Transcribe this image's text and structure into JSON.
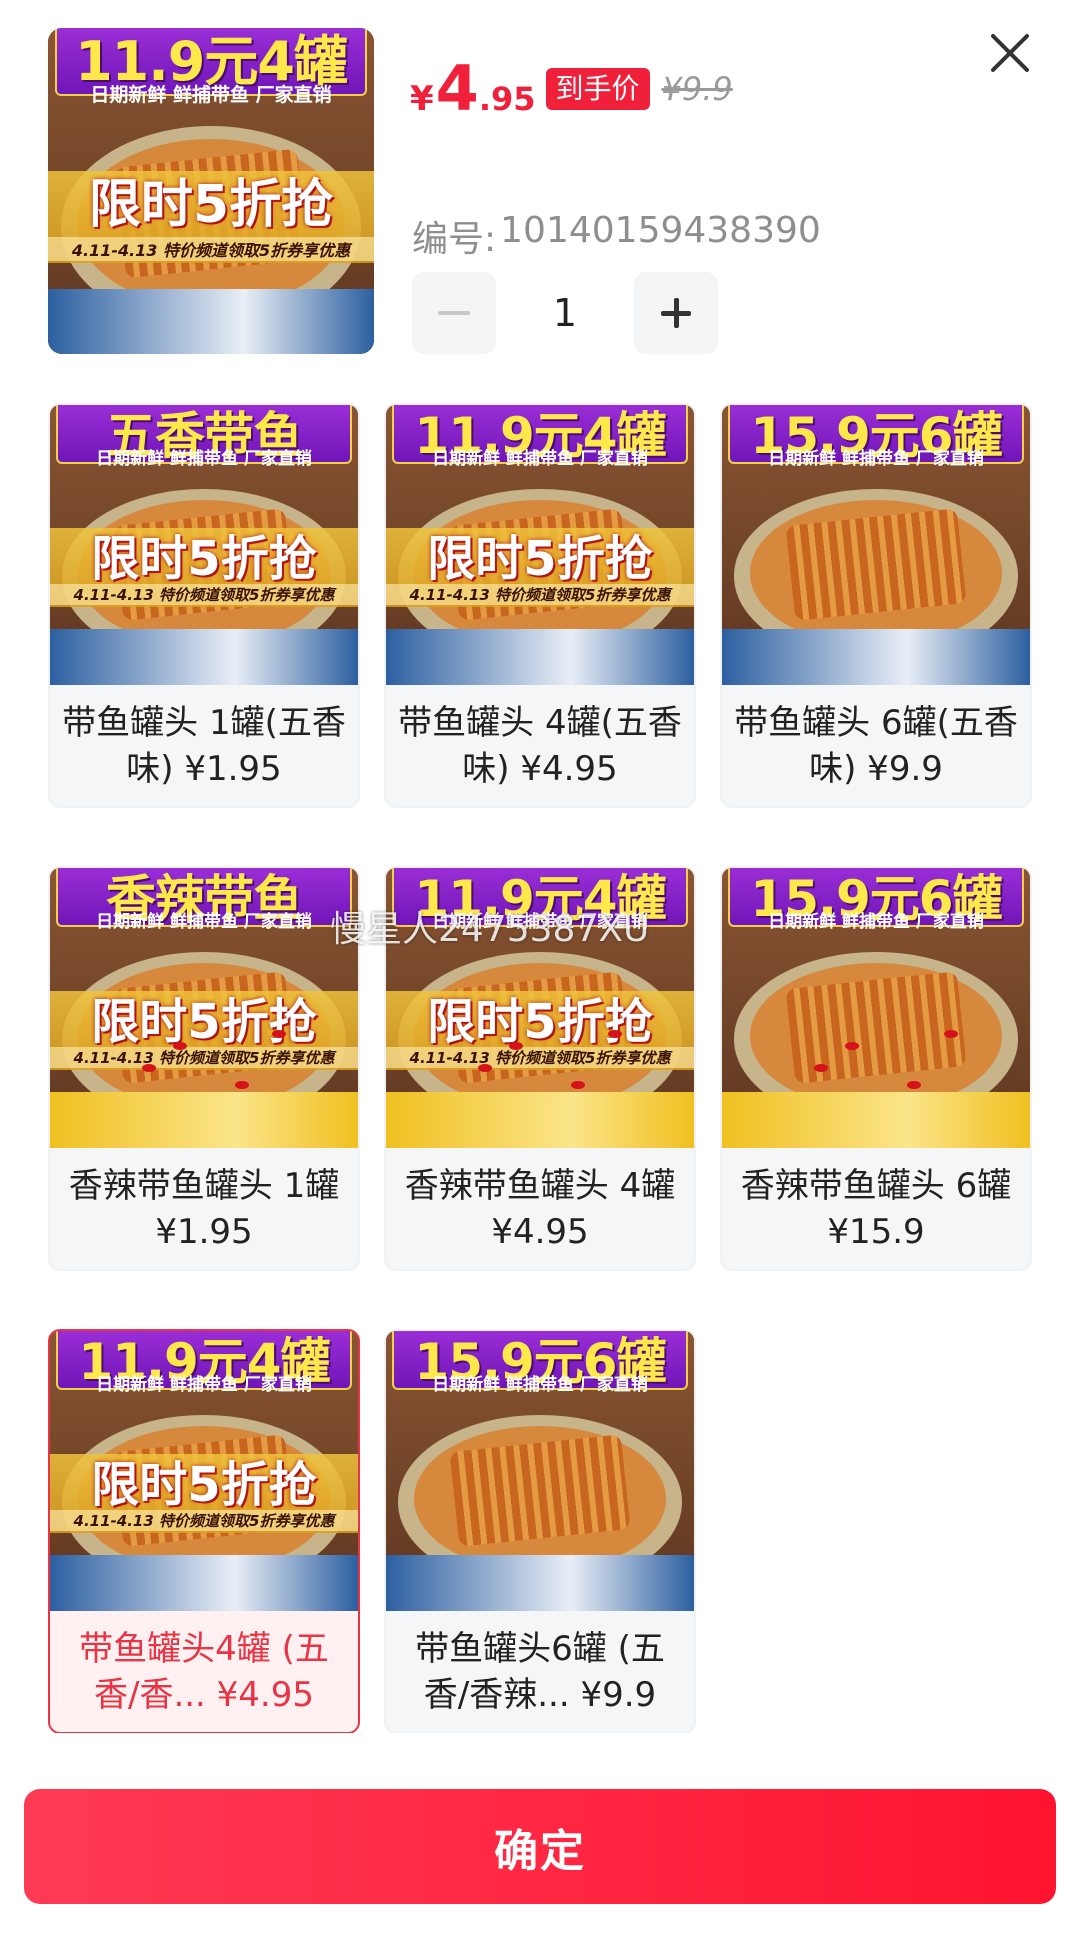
{
  "header": {
    "main_image": {
      "top_title": "11.9元4罐",
      "top_sub": "日期新鲜  鲜捕带鱼  厂家直销",
      "promo_title": "限时5折抢",
      "promo_sub": "4.11-4.13 特价频道领取5折券享优惠",
      "variant": "plain"
    },
    "price": {
      "currency": "¥",
      "integer": "4",
      "decimal": ".95"
    },
    "price_badge": "到手价",
    "original_price": "¥9.9",
    "code_label": "编号:",
    "code_value": "10140159438390",
    "quantity": "1"
  },
  "skus": [
    {
      "label": "带鱼罐头 1罐(五香味) ¥1.95",
      "selected": false,
      "image": {
        "top_title": "五香带鱼",
        "top_sub": "日期新鲜  鲜捕带鱼  厂家直销",
        "promo_title": "限时5折抢",
        "promo_sub": "4.11-4.13 特价频道领取5折券享优惠",
        "variant": "plain"
      }
    },
    {
      "label": "带鱼罐头 4罐(五香味) ¥4.95",
      "selected": false,
      "image": {
        "top_title": "11.9元4罐",
        "top_sub": "日期新鲜  鲜捕带鱼  厂家直销",
        "promo_title": "限时5折抢",
        "promo_sub": "4.11-4.13 特价频道领取5折券享优惠",
        "variant": "plain"
      }
    },
    {
      "label": "带鱼罐头 6罐(五香味) ¥9.9",
      "selected": false,
      "image": {
        "top_title": "15.9元6罐",
        "top_sub": "日期新鲜  鲜捕带鱼  厂家直销",
        "promo_title": "",
        "promo_sub": "",
        "variant": "plain"
      }
    },
    {
      "label": "香辣带鱼罐头 1罐 ¥1.95",
      "selected": false,
      "image": {
        "top_title": "香辣带鱼",
        "top_sub": "日期新鲜  鲜捕带鱼  厂家直销",
        "promo_title": "限时5折抢",
        "promo_sub": "4.11-4.13 特价频道领取5折券享优惠",
        "variant": "spicy"
      }
    },
    {
      "label": "香辣带鱼罐头 4罐 ¥4.95",
      "selected": false,
      "image": {
        "top_title": "11.9元4罐",
        "top_sub": "日期新鲜  鲜捕带鱼  厂家直销",
        "promo_title": "限时5折抢",
        "promo_sub": "4.11-4.13 特价频道领取5折券享优惠",
        "variant": "spicy"
      }
    },
    {
      "label": "香辣带鱼罐头 6罐 ¥15.9",
      "selected": false,
      "image": {
        "top_title": "15.9元6罐",
        "top_sub": "日期新鲜  鲜捕带鱼  厂家直销",
        "promo_title": "",
        "promo_sub": "",
        "variant": "spicy"
      }
    },
    {
      "label": "带鱼罐头4罐 (五香/香... ¥4.95",
      "selected": true,
      "image": {
        "top_title": "11.9元4罐",
        "top_sub": "日期新鲜  鲜捕带鱼  厂家直销",
        "promo_title": "限时5折抢",
        "promo_sub": "4.11-4.13 特价频道领取5折券享优惠",
        "variant": "plain"
      }
    },
    {
      "label": "带鱼罐头6罐 (五香/香辣... ¥9.9",
      "selected": false,
      "image": {
        "top_title": "15.9元6罐",
        "top_sub": "日期新鲜  鲜捕带鱼  厂家直销",
        "promo_title": "",
        "promo_sub": "",
        "variant": "plain"
      }
    }
  ],
  "watermark": "慢星人2475387XU",
  "confirm_label": "确定",
  "colors": {
    "accent": "#f0203a",
    "selected_border": "#e83444",
    "selected_bg": "#fff0f1"
  }
}
